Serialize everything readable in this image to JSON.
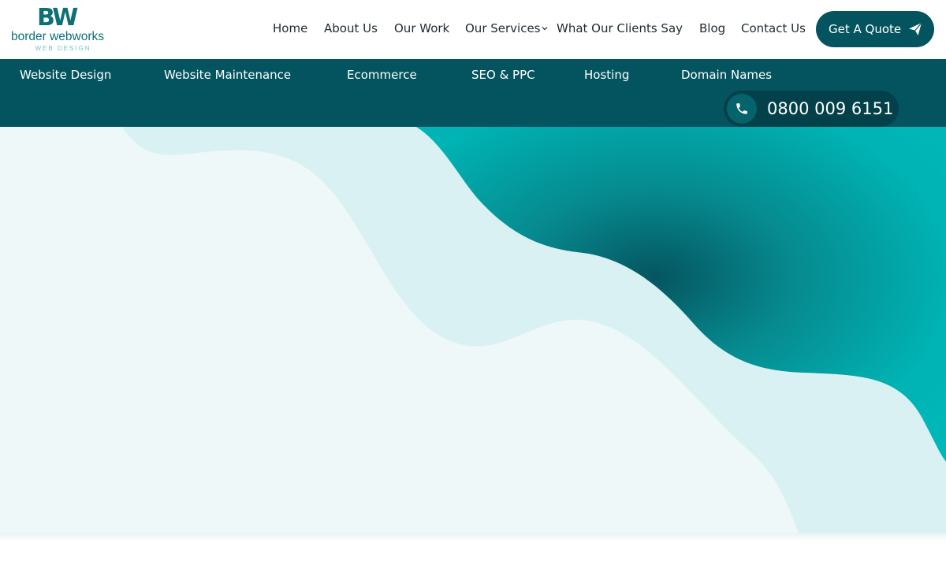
{
  "brand": {
    "mark": "BW",
    "name": "border webworks",
    "tagline": "WEB DESIGN",
    "color": "#0e6f76",
    "tagline_color": "#6fc6c9"
  },
  "main_nav": {
    "items": [
      "Home",
      "About Us",
      "Our Work",
      "Our Services",
      "What Our Clients Say",
      "Blog",
      "Contact Us"
    ],
    "dropdown_icon": "chevron-down-icon"
  },
  "quote_button": {
    "label": "Get A Quote",
    "icon": "paper-plane-icon"
  },
  "services_nav": {
    "items": [
      "Website Design",
      "Website Maintenance",
      "Ecommerce",
      "SEO & PPC",
      "Hosting",
      "Domain Names"
    ]
  },
  "phone": {
    "icon": "phone-icon",
    "number": "0800 009 6151"
  },
  "colors": {
    "primary": "#04545f",
    "accent_teal": "#00b3b4",
    "hero_light": "#eef8f8",
    "hero_mid": "#d9f1f2"
  }
}
